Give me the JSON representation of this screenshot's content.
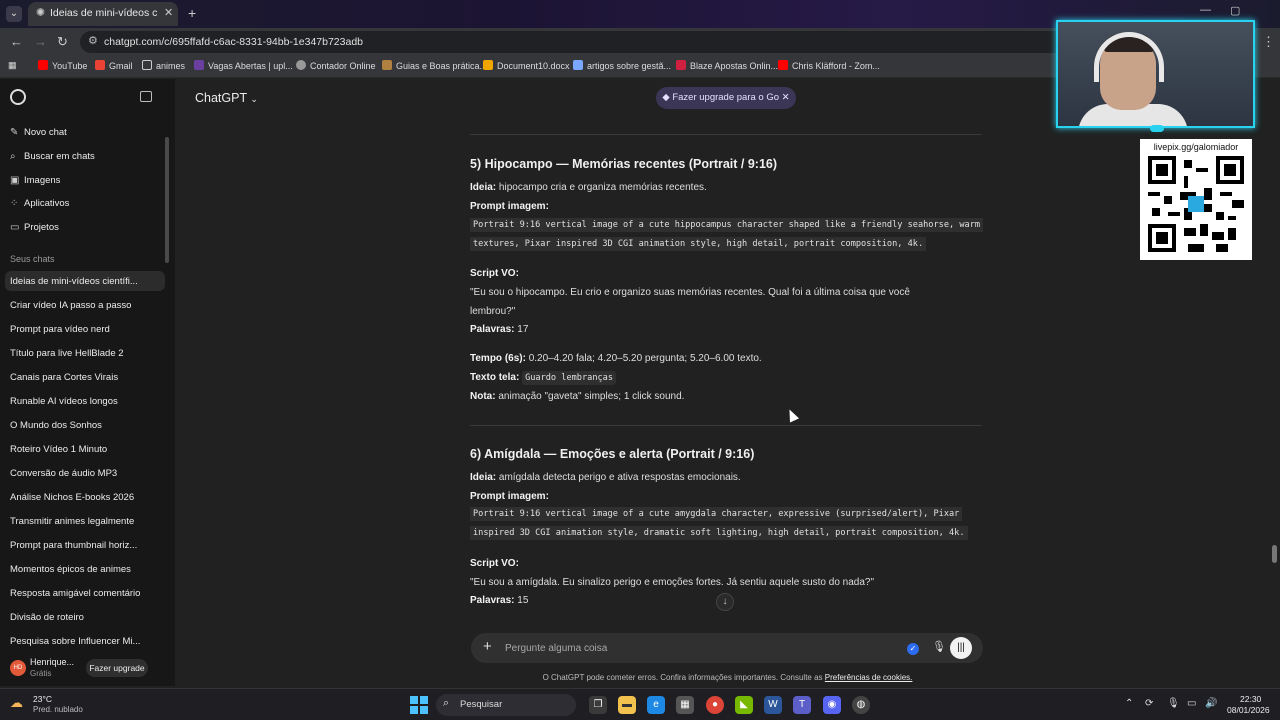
{
  "browser": {
    "tab_title": "Ideias de mini-vídeos científicos",
    "url": "chatgpt.com/c/695ffafd-c6ac-8331-94bb-1e347b723adb",
    "bookmarks": [
      "YouTube",
      "Gmail",
      "animes",
      "Vagas Abertas | upl...",
      "Contador Online",
      "Guias e Boas prática...",
      "Document10.docx",
      "artigos sobre gestã...",
      "Blaze Apostas Onlin...",
      "Chris Kläfford - Zom..."
    ]
  },
  "sidebar": {
    "nav": [
      {
        "label": "Novo chat",
        "icon": "edit-icon"
      },
      {
        "label": "Buscar em chats",
        "icon": "search-icon"
      },
      {
        "label": "Imagens",
        "icon": "image-icon"
      },
      {
        "label": "Aplicativos",
        "icon": "apps-icon"
      },
      {
        "label": "Projetos",
        "icon": "folder-icon"
      }
    ],
    "section_title": "Seus chats",
    "chats": [
      "Ideias de mini-vídeos científi...",
      "Criar vídeo IA passo a passo",
      "Prompt para vídeo nerd",
      "Título para live HellBlade 2",
      "Canais para Cortes Virais",
      "Runable AI vídeos longos",
      "O Mundo dos Sonhos",
      "Roteiro Vídeo 1 Minuto",
      "Conversão de áudio MP3",
      "Análise Nichos E-books 2026",
      "Transmitir animes legalmente",
      "Prompt para thumbnail horiz...",
      "Momentos épicos de animes",
      "Resposta amigável comentário",
      "Divisão de roteiro",
      "Pesquisa sobre Influencer Mi..."
    ],
    "user": {
      "initials": "HD",
      "name": "Henrique...",
      "plan": "Grátis",
      "upgrade": "Fazer upgrade"
    }
  },
  "header": {
    "model": "ChatGPT",
    "upgrade_pill": "Fazer upgrade para o Go"
  },
  "content": {
    "s5": {
      "title": "5) Hipocampo — Memórias recentes (Portrait / 9:16)",
      "ideia_label": "Ideia:",
      "ideia": "hipocampo cria e organiza memórias recentes.",
      "prompt_label": "Prompt imagem:",
      "prompt_l1": "Portrait 9:16 vertical image of a cute hippocampus character shaped like a friendly seahorse, warm",
      "prompt_l2": "textures, Pixar inspired 3D CGI animation style, high detail, portrait composition, 4k.",
      "script_label": "Script VO:",
      "script_l1": "\"Eu sou o hipocampo. Eu crio e organizo suas memórias recentes. Qual foi a última coisa que você",
      "script_l2": "lembrou?\"",
      "palavras_label": "Palavras:",
      "palavras": "17",
      "tempo_label": "Tempo (6s):",
      "tempo": "0.20–4.20 fala; 4.20–5.20 pergunta; 5.20–6.00 texto.",
      "texto_label": "Texto tela:",
      "texto": "Guardo lembranças",
      "nota_label": "Nota:",
      "nota": "animação \"gaveta\" simples; 1 click sound."
    },
    "s6": {
      "title": "6) Amígdala — Emoções e alerta (Portrait / 9:16)",
      "ideia_label": "Ideia:",
      "ideia": "amígdala detecta perigo e ativa respostas emocionais.",
      "prompt_label": "Prompt imagem:",
      "prompt_l1": "Portrait 9:16 vertical image of a cute amygdala character, expressive (surprised/alert), Pixar",
      "prompt_l2": "inspired 3D CGI animation style, dramatic soft lighting, high detail, portrait composition, 4k.",
      "script_label": "Script VO:",
      "script": "\"Eu sou a amígdala. Eu sinalizo perigo e emoções fortes. Já sentiu aquele susto do nada?\"",
      "palavras_label": "Palavras:",
      "palavras": "15"
    }
  },
  "composer": {
    "placeholder": "Pergunte alguma coisa"
  },
  "disclaimer": {
    "text": "O ChatGPT pode cometer erros. Confira informações importantes. Consulte as",
    "link": "Preferências de cookies."
  },
  "overlay": {
    "qr_label": "livepix.gg/galomiador"
  },
  "taskbar": {
    "temp": "23°C",
    "weather": "Pred. nublado",
    "search": "Pesquisar",
    "time": "22:30",
    "date": "08/01/2026"
  }
}
